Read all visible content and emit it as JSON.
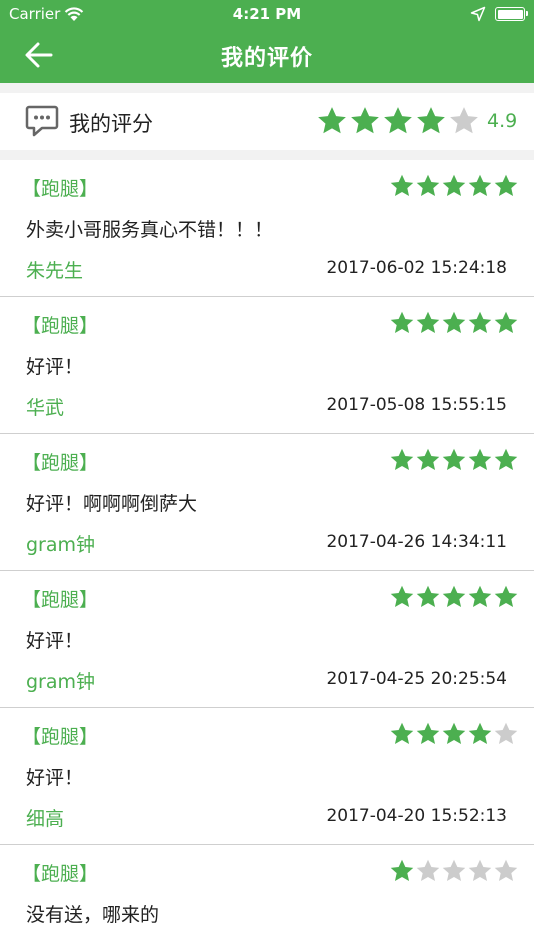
{
  "status_bar": {
    "carrier": "Carrier",
    "time": "4:21 PM",
    "icons": [
      "wifi-icon",
      "location-arrow-icon",
      "battery-icon"
    ]
  },
  "nav": {
    "title": "我的评价",
    "back_icon": "arrow-left-icon"
  },
  "summary": {
    "label": "我的评分",
    "icon": "chat-bubble-icon",
    "rating": 4,
    "score": "4.9"
  },
  "colors": {
    "accent": "#4caf50",
    "star_on": "#4caf50",
    "star_off": "#cccccc"
  },
  "reviews": [
    {
      "tag": "【跑腿】",
      "rating": 5,
      "content": "外卖小哥服务真心不错！！！",
      "user": "朱先生",
      "date": "2017-06-02 15:24:18"
    },
    {
      "tag": "【跑腿】",
      "rating": 5,
      "content": "好评！",
      "user": "华武",
      "date": "2017-05-08 15:55:15"
    },
    {
      "tag": "【跑腿】",
      "rating": 5,
      "content": "好评！啊啊啊倒萨大",
      "user": "gram钟",
      "date": "2017-04-26 14:34:11"
    },
    {
      "tag": "【跑腿】",
      "rating": 5,
      "content": "好评！",
      "user": "gram钟",
      "date": "2017-04-25 20:25:54"
    },
    {
      "tag": "【跑腿】",
      "rating": 4,
      "content": "好评！",
      "user": "细高",
      "date": "2017-04-20 15:52:13"
    },
    {
      "tag": "【跑腿】",
      "rating": 1,
      "content": "没有送，哪来的",
      "user": "",
      "date": ""
    }
  ]
}
